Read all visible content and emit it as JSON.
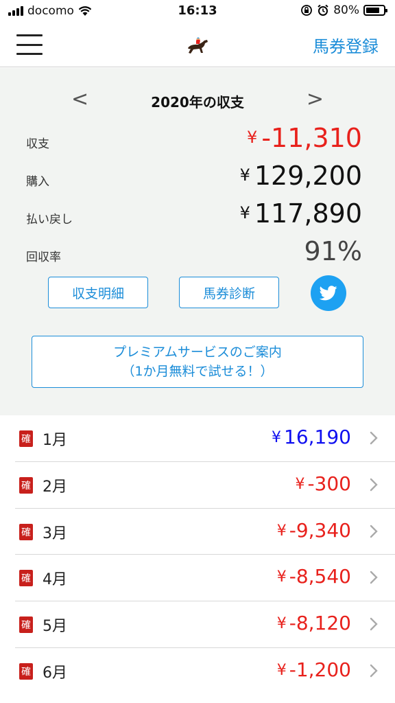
{
  "status_bar": {
    "carrier": "docomo",
    "time": "16:13",
    "battery": "80%",
    "battery_level": 0.8
  },
  "nav": {
    "register_label": "馬券登録",
    "logo_icon": "horse-racing-icon"
  },
  "summary": {
    "prev": "<",
    "next": ">",
    "year_title": "2020年の収支",
    "rows": [
      {
        "label": "収支",
        "currency": "¥",
        "value": "-11,310",
        "color": "#e8211c"
      },
      {
        "label": "購入",
        "currency": "¥",
        "value": "129,200",
        "color": "#111111"
      },
      {
        "label": "払い戻し",
        "currency": "¥",
        "value": "117,890",
        "color": "#111111"
      },
      {
        "label": "回収率",
        "currency": "",
        "value": "91%",
        "color": "#444444"
      }
    ],
    "detail_button": "収支明細",
    "diagnosis_button": "馬券診断",
    "twitter_icon": "twitter-icon",
    "premium_line1": "プレミアムサービスのご案内",
    "premium_line2": "（1か月無料で試せる！）"
  },
  "months": [
    {
      "badge": "確",
      "label": "1月",
      "currency": "¥",
      "value": "16,190",
      "color": "#1010f0"
    },
    {
      "badge": "確",
      "label": "2月",
      "currency": "¥",
      "value": "-300",
      "color": "#e8211c"
    },
    {
      "badge": "確",
      "label": "3月",
      "currency": "¥",
      "value": "-9,340",
      "color": "#e8211c"
    },
    {
      "badge": "確",
      "label": "4月",
      "currency": "¥",
      "value": "-8,540",
      "color": "#e8211c"
    },
    {
      "badge": "確",
      "label": "5月",
      "currency": "¥",
      "value": "-8,120",
      "color": "#e8211c"
    },
    {
      "badge": "確",
      "label": "6月",
      "currency": "¥",
      "value": "-1,200",
      "color": "#e8211c"
    }
  ],
  "colors": {
    "accent": "#1a8cd8",
    "negative": "#e8211c",
    "positive": "#1010f0",
    "badge": "#c8201c",
    "summary_bg": "#f2f4f2"
  }
}
